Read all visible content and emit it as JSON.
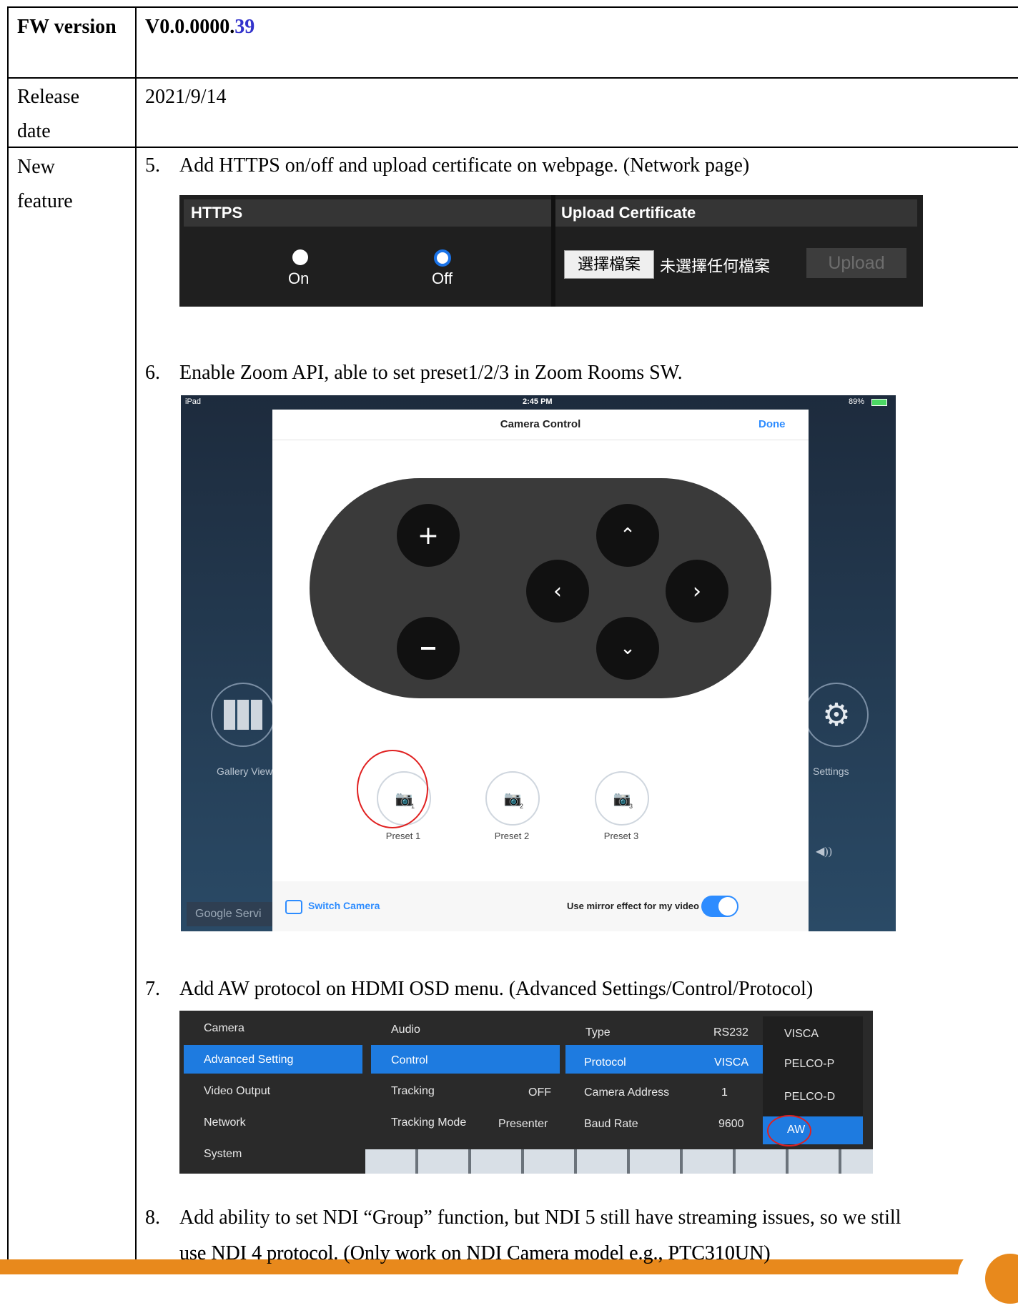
{
  "table": {
    "fw_label": "FW version",
    "fw_value_prefix": "V0.0.0000.",
    "fw_value_suffix": "39",
    "release_label": "Release date",
    "release_value": "2021/9/14",
    "feature_label": "New feature"
  },
  "items": [
    {
      "num": "5.",
      "text": "Add HTTPS on/off and upload certificate on webpage. (Network page)"
    },
    {
      "num": "6.",
      "text": "Enable Zoom API, able to set preset1/2/3 in Zoom Rooms SW."
    },
    {
      "num": "7.",
      "text": "Add AW protocol on HDMI OSD menu. (Advanced Settings/Control/Protocol)"
    },
    {
      "num": "8.",
      "text": "Add ability to set NDI “Group” function, but NDI 5 still have streaming issues, so we still",
      "text2": "use NDI 4 protocol. (Only work on NDI Camera model e.g., PTC310UN)"
    }
  ],
  "https_panel": {
    "https_title": "HTTPS",
    "on_label": "On",
    "off_label": "Off",
    "selected": "Off",
    "upload_title": "Upload Certificate",
    "choose_file_button": "選擇檔案",
    "no_file_text": "未選擇任何檔案",
    "upload_button": "Upload"
  },
  "ipad": {
    "status_left": "iPad",
    "status_time": "2:45 PM",
    "status_battery": "89%",
    "modal_title": "Camera Control",
    "done": "Done",
    "presets": [
      "Preset 1",
      "Preset 2",
      "Preset 3"
    ],
    "preset_numbers": [
      "1",
      "2",
      "3"
    ],
    "switch_camera": "Switch Camera",
    "mirror_label": "Use mirror effect for my video",
    "mirror_on": true,
    "bg_gallery": "Gallery View",
    "bg_settings": "Settings",
    "bg_google": "Google Servi"
  },
  "osd": {
    "col1": [
      "Camera",
      "Advanced Setting",
      "Video Output",
      "Network",
      "System"
    ],
    "col2": [
      "Audio",
      "Control",
      "Tracking",
      "Tracking Mode"
    ],
    "col2_values": [
      "",
      "",
      "OFF",
      "Presenter"
    ],
    "col3": [
      "Type",
      "Protocol",
      "Camera Address",
      "Baud Rate"
    ],
    "col3_values": [
      "RS232",
      "VISCA",
      "1",
      "9600"
    ],
    "col4": [
      "VISCA",
      "PELCO-P",
      "PELCO-D",
      "AW"
    ],
    "highlight_color": "#1e7be0"
  }
}
